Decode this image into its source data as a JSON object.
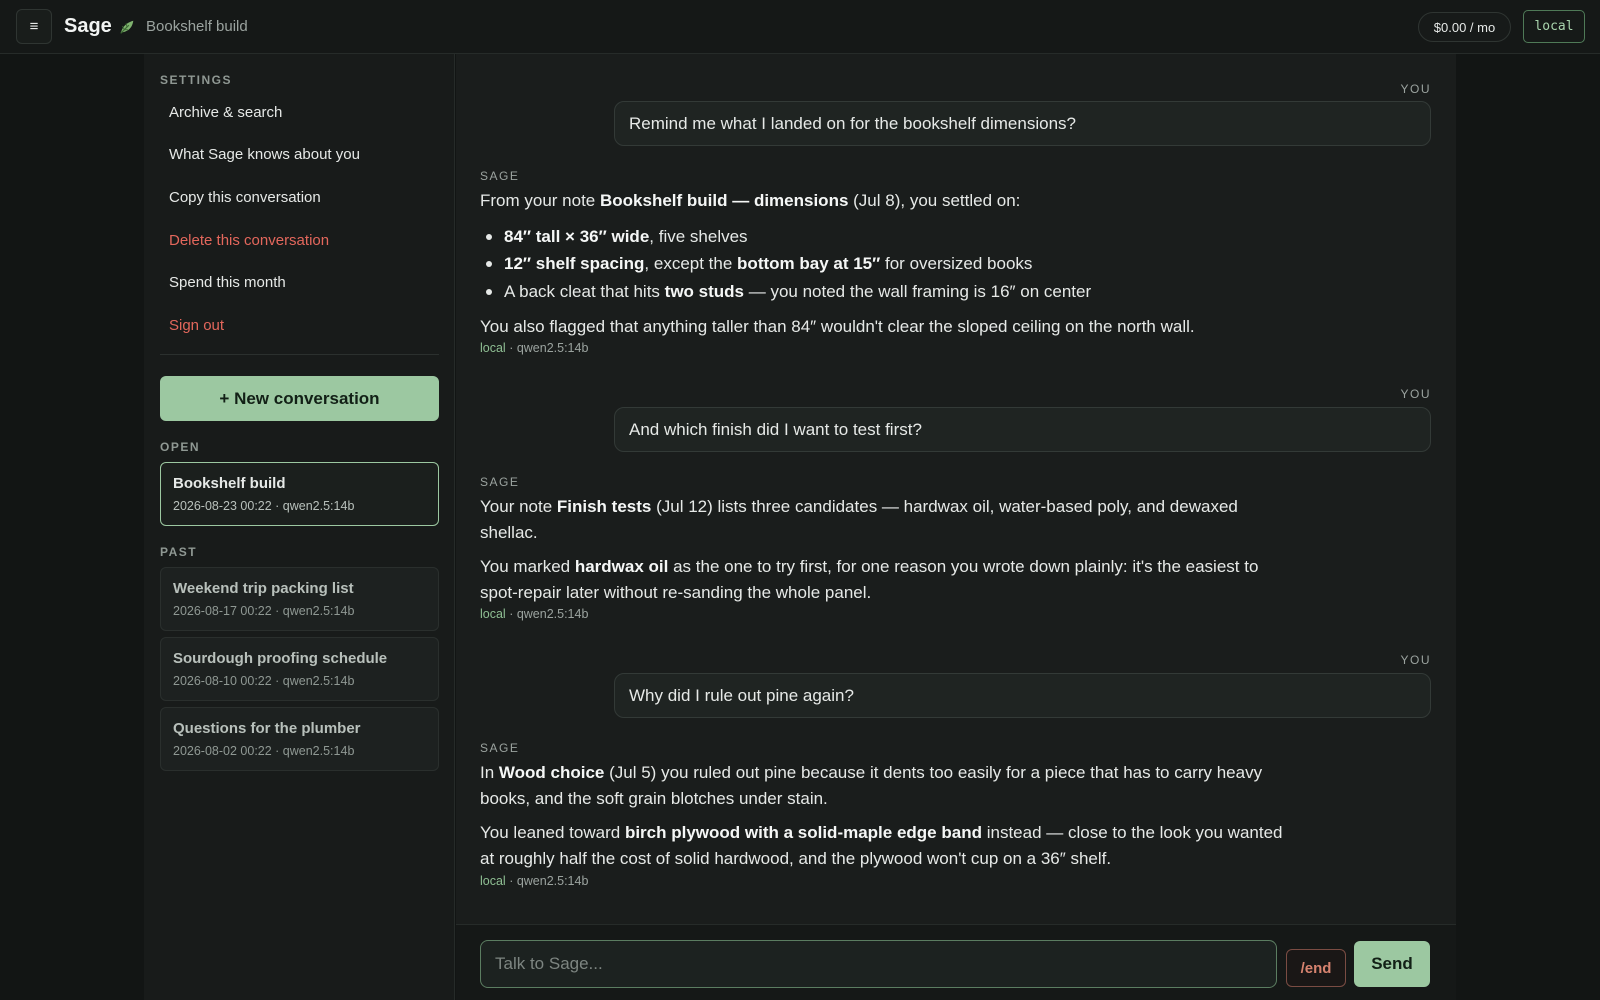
{
  "app": {
    "name": "Sage",
    "brand_icon": "leaf-icon",
    "breadcrumb": "Bookshelf build",
    "spend": "$0.00 / mo",
    "mode": "local",
    "menu_icon": "≡",
    "colors": {
      "accent": "#9cc8a1",
      "danger": "#e3675c",
      "background": "#121514"
    }
  },
  "sidebar": {
    "settings_label": "SETTINGS",
    "settings": [
      {
        "label": "Archive & search",
        "danger": false
      },
      {
        "label": "What Sage knows about you",
        "danger": false
      },
      {
        "label": "Copy this conversation",
        "danger": false
      },
      {
        "label": "Delete this conversation",
        "danger": true
      },
      {
        "label": "Spend this month",
        "danger": false
      },
      {
        "label": "Sign out",
        "danger": true
      }
    ],
    "new_conversation": "+ New conversation",
    "open_label": "OPEN",
    "open": [
      {
        "title": "Bookshelf build",
        "meta": "2026-08-23 00:22 · qwen2.5:14b"
      }
    ],
    "past_label": "PAST",
    "past": [
      {
        "title": "Weekend trip packing list",
        "meta": "2026-08-17 00:22 · qwen2.5:14b"
      },
      {
        "title": "Sourdough proofing schedule",
        "meta": "2026-08-10 00:22 · qwen2.5:14b"
      },
      {
        "title": "Questions for the plumber",
        "meta": "2026-08-02 00:22 · qwen2.5:14b"
      }
    ]
  },
  "chat": {
    "you_label": "YOU",
    "sage_label": "SAGE",
    "meta_source": "local",
    "meta_model": "qwen2.5:14b",
    "turns": [
      {
        "user": "Remind me what I landed on for the bookshelf dimensions?",
        "reply": {
          "intro": {
            "a": "From your note ",
            "b": "Bookshelf build — dimensions",
            "c": " (Jul 8), you settled on:"
          },
          "bullets": [
            {
              "b": "84″ tall × 36″ wide",
              "a": ", five shelves"
            },
            {
              "b1": "12″ shelf spacing",
              "a1": ", except the ",
              "b2": "bottom bay at 15″",
              "a2": " for oversized books"
            },
            {
              "a1": "A back cleat that hits ",
              "b": "two studs",
              "a2": " — you noted the wall framing is 16″ on center"
            }
          ],
          "outro": "You also flagged that anything taller than 84″ wouldn't clear the sloped ceiling on the north wall."
        }
      },
      {
        "user": "And which finish did I want to test first?",
        "reply": {
          "p1": {
            "a": "Your note ",
            "b": "Finish tests",
            "c": " (Jul 12) lists three candidates — hardwax oil, water-based poly, and dewaxed shellac."
          },
          "p2": {
            "a": "You marked ",
            "b": "hardwax oil",
            "c": " as the one to try first, for one reason you wrote down plainly: it's the easiest to spot-repair later without re-sanding the whole panel."
          }
        }
      },
      {
        "user": "Why did I rule out pine again?",
        "reply": {
          "p1": {
            "a": "In ",
            "b": "Wood choice",
            "c": " (Jul 5) you ruled out pine because it dents too easily for a piece that has to carry heavy books, and the soft grain blotches under stain."
          },
          "p2": {
            "a": "You leaned toward ",
            "b": "birch plywood with a solid-maple edge band",
            "c": " instead — close to the look you wanted at roughly half the cost of solid hardwood, and the plywood won't cup on a 36″ shelf."
          }
        }
      }
    ]
  },
  "composer": {
    "placeholder": "Talk to Sage...",
    "value": "",
    "end_label": "/end",
    "send_label": "Send"
  }
}
